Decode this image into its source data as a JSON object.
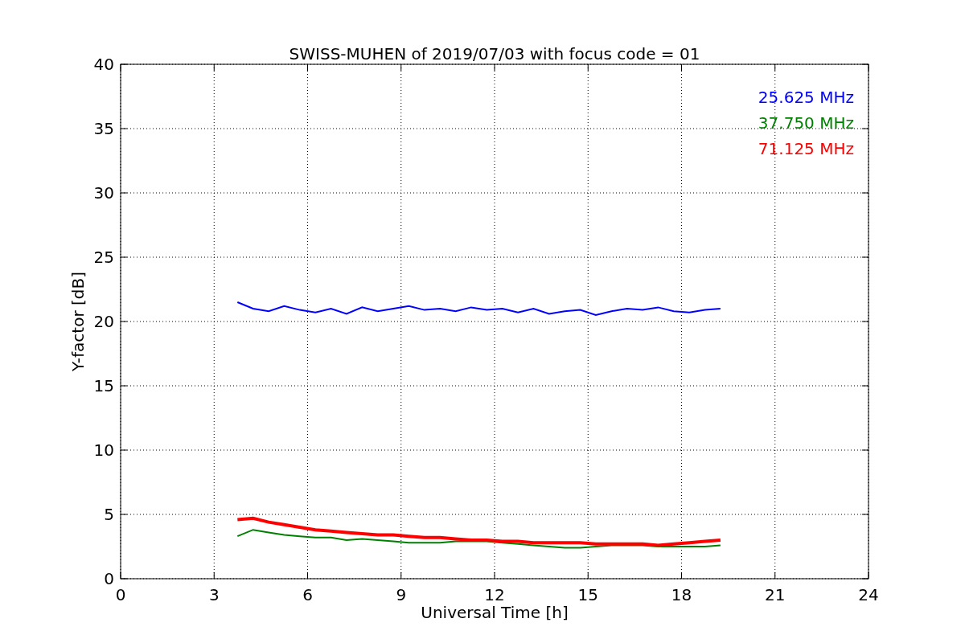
{
  "figure": {
    "chart_data": {
      "type": "line",
      "title": "SWISS-MUHEN of 2019/07/03 with focus code = 01",
      "xlabel": "Universal Time [h]",
      "ylabel": "Y-factor [dB]",
      "x": [
        3.75,
        4.25,
        4.75,
        5.25,
        5.75,
        6.25,
        6.75,
        7.25,
        7.75,
        8.25,
        8.75,
        9.25,
        9.75,
        10.25,
        10.75,
        11.25,
        11.75,
        12.25,
        12.75,
        13.25,
        13.75,
        14.25,
        14.75,
        15.25,
        15.75,
        16.25,
        16.75,
        17.25,
        17.75,
        18.25,
        18.75,
        19.25
      ],
      "series": [
        {
          "name": "25.625 MHz",
          "color": "#0000ff",
          "values": [
            21.5,
            21.0,
            20.8,
            21.2,
            20.9,
            20.7,
            21.0,
            20.6,
            21.1,
            20.8,
            21.0,
            21.2,
            20.9,
            21.0,
            20.8,
            21.1,
            20.9,
            21.0,
            20.7,
            21.0,
            20.6,
            20.8,
            20.9,
            20.5,
            20.8,
            21.0,
            20.9,
            21.1,
            20.8,
            20.7,
            20.9,
            21.0
          ]
        },
        {
          "name": "37.750 MHz",
          "color": "#008000",
          "values": [
            3.3,
            3.8,
            3.6,
            3.4,
            3.3,
            3.2,
            3.2,
            3.0,
            3.1,
            3.0,
            2.9,
            2.8,
            2.8,
            2.8,
            2.9,
            2.9,
            2.9,
            2.8,
            2.7,
            2.6,
            2.5,
            2.4,
            2.4,
            2.5,
            2.6,
            2.6,
            2.6,
            2.5,
            2.5,
            2.5,
            2.5,
            2.6
          ]
        },
        {
          "name": "71.125 MHz",
          "color": "#ff0000",
          "values": [
            4.6,
            4.7,
            4.4,
            4.2,
            4.0,
            3.8,
            3.7,
            3.6,
            3.5,
            3.4,
            3.4,
            3.3,
            3.2,
            3.2,
            3.1,
            3.0,
            3.0,
            2.9,
            2.9,
            2.8,
            2.8,
            2.8,
            2.8,
            2.7,
            2.7,
            2.7,
            2.7,
            2.6,
            2.7,
            2.8,
            2.9,
            3.0
          ]
        }
      ],
      "xlim": [
        0,
        24
      ],
      "ylim": [
        0,
        40
      ],
      "xticks": [
        0,
        3,
        6,
        9,
        12,
        15,
        18,
        21,
        24
      ],
      "yticks": [
        0,
        5,
        10,
        15,
        20,
        25,
        30,
        35,
        40
      ],
      "grid": true
    }
  }
}
